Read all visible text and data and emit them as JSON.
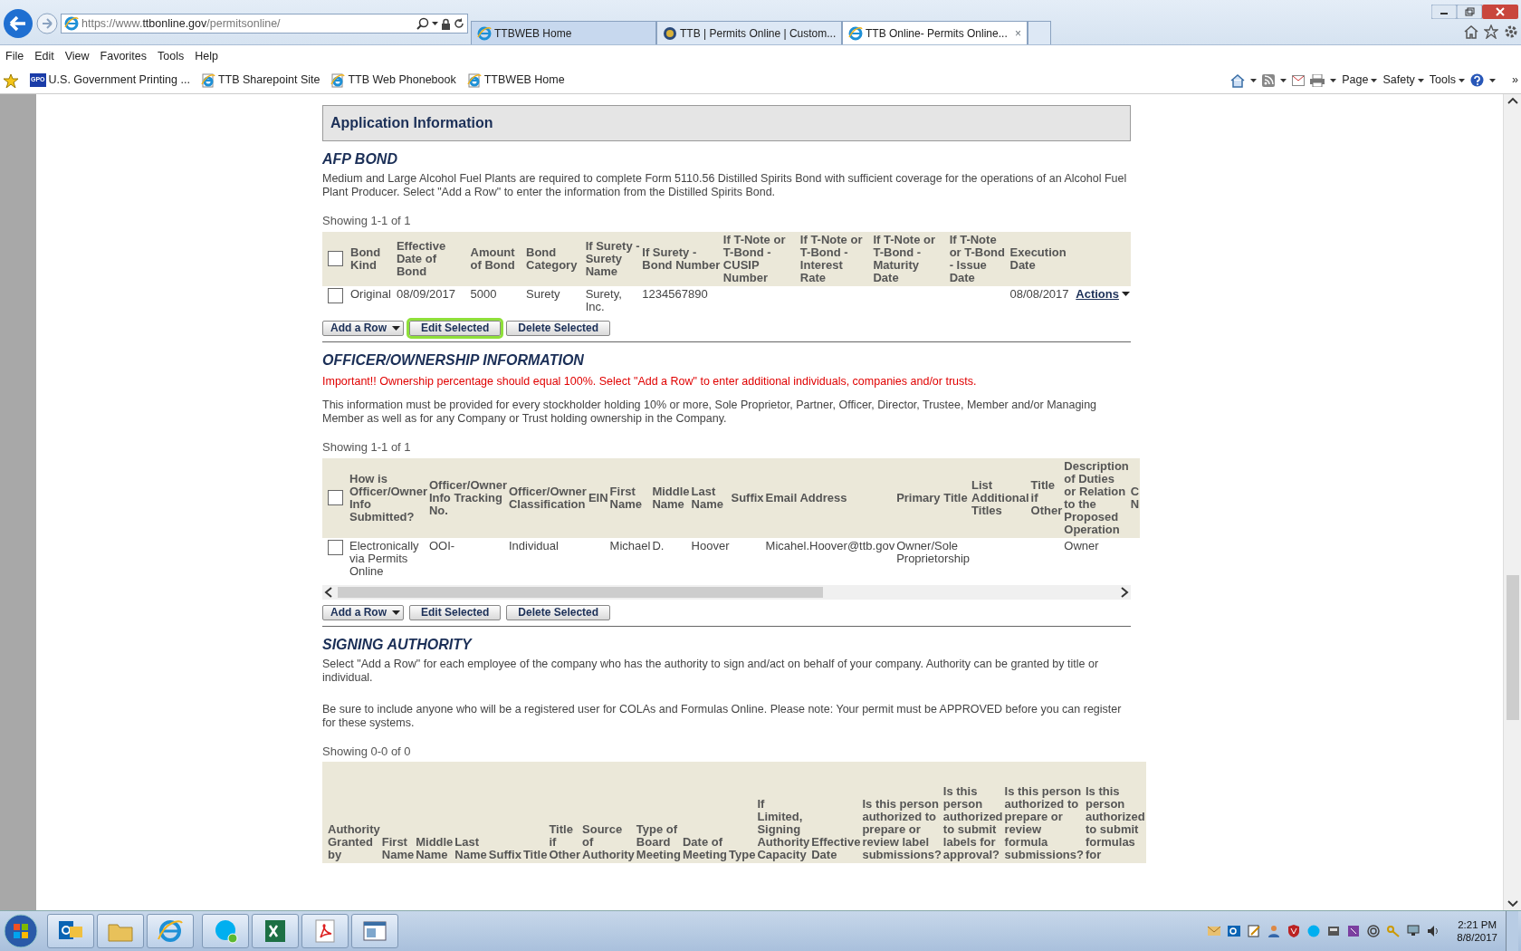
{
  "browser": {
    "address": {
      "prefix": "https://www.",
      "domain": "ttbonline.gov",
      "path": "/permitsonline/"
    },
    "tabs": [
      {
        "title": "TTBWEB Home",
        "kind": "ie",
        "selected": false
      },
      {
        "title": "TTB | Permits Online | Custom...",
        "kind": "seal",
        "selected": false
      },
      {
        "title": "TTB Online- Permits Online...",
        "kind": "ie",
        "selected": true,
        "close": "×"
      }
    ],
    "menu": [
      "File",
      "Edit",
      "View",
      "Favorites",
      "Tools",
      "Help"
    ],
    "favorites": [
      {
        "label": "U.S. Government Printing ...",
        "badge": "GPO",
        "kind": "badge"
      },
      {
        "label": "TTB Sharepoint Site",
        "kind": "ie"
      },
      {
        "label": "TTB Web Phonebook",
        "kind": "ie"
      },
      {
        "label": "TTBWEB Home",
        "kind": "ie"
      }
    ],
    "command_bar": [
      "Page",
      "Safety",
      "Tools"
    ],
    "overflow": "»"
  },
  "page": {
    "header": "Application Information",
    "sections": [
      {
        "title": "AFP BOND",
        "paragraphs": [
          "Medium and Large Alcohol Fuel Plants are required to complete Form 5110.56 Distilled Spirits Bond with sufficient coverage for the operations of an Alcohol Fuel Plant Producer. Select \"Add a Row\" to enter the information from the Distilled Spirits Bond."
        ],
        "showing": "Showing 1-1 of 1",
        "table": {
          "select_column": true,
          "scrollable": false,
          "columns": [
            "Bond Kind",
            "Effective Date of Bond",
            "Amount of Bond",
            "Bond Category",
            "If Surety - Surety Name",
            "If Surety - Bond Number",
            "If T-Note or T-Bond - CUSIP Number",
            "If T-Note or T-Bond - Interest Rate",
            "If T-Note or T-Bond - Maturity Date",
            "If T-Note or T-Bond - Issue Date",
            "Execution Date"
          ],
          "header_checked": false,
          "rows": [
            {
              "checked": false,
              "cells": [
                "Original",
                "08/09/2017",
                "5000",
                "Surety",
                "Surety, Inc.",
                "1234567890",
                null,
                null,
                null,
                null,
                "08/08/2017"
              ],
              "action": "Actions"
            }
          ]
        },
        "buttons": [
          {
            "label": "Add a Row",
            "kind": "split",
            "focused": false
          },
          {
            "label": "Edit Selected",
            "kind": "plain",
            "focused": true
          },
          {
            "label": "Delete Selected",
            "kind": "plain",
            "focused": false
          }
        ]
      },
      {
        "title": "OFFICER/OWNERSHIP INFORMATION",
        "notice": "Important!! Ownership percentage should equal 100%. Select \"Add a Row\" to enter additional individuals, companies and/or trusts.",
        "paragraphs": [
          "This information must be provided for every stockholder holding 10% or more, Sole Proprietor, Partner, Officer, Director, Trustee, Member and/or Managing Member as well as for any Company or Trust holding ownership in the Company."
        ],
        "showing": "Showing 1-1 of 1",
        "table": {
          "select_column": true,
          "scrollable": true,
          "columns": [
            "How is Officer/Owner Info Submitted?",
            "Officer/Owner Info Tracking No.",
            "Officer/Owner Classification",
            "EIN",
            "First Name",
            "Middle Name",
            "Last Name",
            "Suffix",
            "Email Address",
            "Primary Title",
            "List Additional Titles",
            "Title if Other",
            "Description of Duties or Relation to the Proposed Operation",
            "C N"
          ],
          "header_checked": false,
          "rows": [
            {
              "checked": false,
              "cells": [
                "Electronically via Permits Online",
                "OOI-",
                "Individual",
                null,
                "Michael",
                "D.",
                "Hoover",
                null,
                "Micahel.Hoover@ttb.gov",
                "Owner/Sole Proprietorship",
                null,
                null,
                "Owner",
                null
              ]
            }
          ]
        },
        "buttons": [
          {
            "label": "Add a Row",
            "kind": "split",
            "focused": false
          },
          {
            "label": "Edit Selected",
            "kind": "plain",
            "focused": false
          },
          {
            "label": "Delete Selected",
            "kind": "plain",
            "focused": false
          }
        ]
      },
      {
        "title": "SIGNING AUTHORITY",
        "paragraphs": [
          "Select \"Add a Row\" for each employee of the company who has the authority to sign and/act on behalf of your company. Authority can be granted by title or individual.",
          "Be sure to include anyone who will be a registered user for COLAs and Formulas Online. Please note: Your permit must be APPROVED before you can register for these systems."
        ],
        "showing": "Showing 0-0 of 0",
        "table": {
          "select_column": false,
          "scrollable": false,
          "columns": [
            "Authority Granted by",
            "First Name",
            "Middle Name",
            "Last Name",
            "Suffix",
            "Title",
            "Title if Other",
            "Source of Authority",
            "Type of Board Meeting",
            "Date of Meeting",
            "Type",
            "If Limited, Signing Authority Capacity",
            "Effective Date",
            "Is this person authorized to prepare or review label submissions?",
            "Is this person authorized to submit labels for approval?",
            "Is this person authorized to prepare or review formula submissions?",
            "Is this person authorized to submit formulas for"
          ]
        }
      }
    ]
  },
  "taskbar": {
    "time": "2:21 PM",
    "date": "8/8/2017"
  }
}
